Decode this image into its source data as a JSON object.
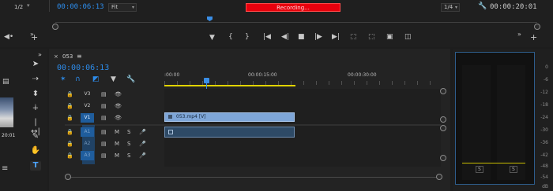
{
  "monitor": {
    "left_fraction": "1/2",
    "timecode": "00:00:06:13",
    "zoom": "Fit",
    "recording": "Recording...",
    "right_fraction": "1/4",
    "right_timecode": "00:00:20:01"
  },
  "sequence": {
    "name": "053",
    "timecode": "00:00:06:13",
    "ruler": [
      ":00:00",
      "00:00:15:00",
      "00:00:30:00"
    ]
  },
  "tracks": [
    {
      "id": "V3",
      "type": "video",
      "targeted": false
    },
    {
      "id": "V2",
      "type": "video",
      "targeted": false
    },
    {
      "id": "V1",
      "type": "video",
      "targeted": true
    },
    {
      "id": "A1",
      "type": "audio",
      "targeted": true
    },
    {
      "id": "A2",
      "type": "audio",
      "targeted": false
    },
    {
      "id": "A3",
      "type": "audio",
      "targeted": false
    }
  ],
  "audio_buttons": {
    "mute": "M",
    "solo": "S"
  },
  "clip": {
    "label": "053.mp4 [V]"
  },
  "left_panel": {
    "thumb_time": "20:01"
  },
  "meter": {
    "db_labels": [
      "0",
      "-6",
      "-12",
      "-18",
      "-24",
      "-30",
      "-36",
      "-42",
      "-48",
      "-54",
      "dB"
    ],
    "solo_left": "S",
    "solo_right": "S"
  },
  "colors": {
    "accent": "#2d8ceb",
    "recording": "#e8000d",
    "clip_video": "#7ea6d8",
    "clip_audio": "#2e4a66",
    "work_area": "#e1d300"
  }
}
